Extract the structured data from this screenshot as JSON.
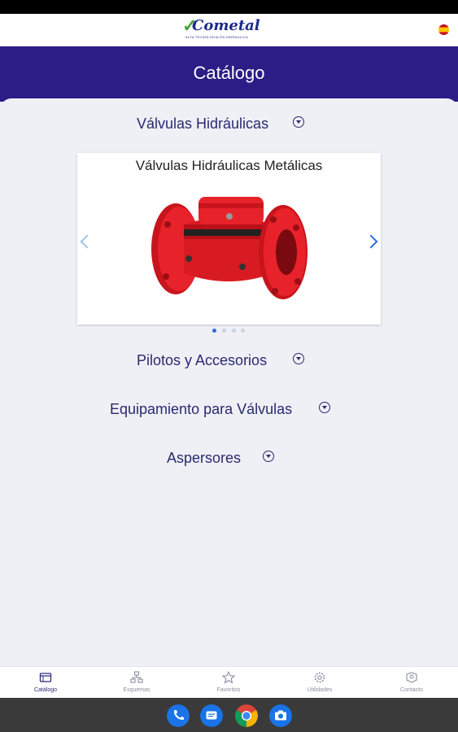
{
  "brand": {
    "logo_text": "Cometal",
    "tagline": "ALTA TECNOLOGIA EN HIDRAULICA",
    "language_flag": "es-flag-icon"
  },
  "header": {
    "title": "Catálogo"
  },
  "catalog": {
    "categories": [
      {
        "label": "Válvulas Hidráulicas"
      },
      {
        "label": "Pilotos y Accesorios"
      },
      {
        "label": "Equipamiento para Válvulas"
      },
      {
        "label": "Aspersores"
      }
    ],
    "carousel": {
      "title": "Válvulas Hidráulicas Metálicas",
      "image": "red-hydraulic-valve",
      "active_index": 1,
      "total": 4
    }
  },
  "tab_bar": {
    "tabs": [
      {
        "label": "Catálogo",
        "icon": "catalog-icon",
        "active": true
      },
      {
        "label": "Esquemas",
        "icon": "schema-icon",
        "active": false
      },
      {
        "label": "Favoritos",
        "icon": "star-icon",
        "active": false
      },
      {
        "label": "Utilidades",
        "icon": "gear-icon",
        "active": false
      },
      {
        "label": "Contacto",
        "icon": "contact-icon",
        "active": false
      }
    ]
  },
  "dock": {
    "apps": [
      "phone-icon",
      "messages-icon",
      "chrome-icon",
      "camera-icon"
    ]
  },
  "colors": {
    "header_bg": "#2c1c86",
    "accent_blue": "#2a6de0",
    "text_dark": "#2a2a6e",
    "valve_red": "#e8222a"
  }
}
